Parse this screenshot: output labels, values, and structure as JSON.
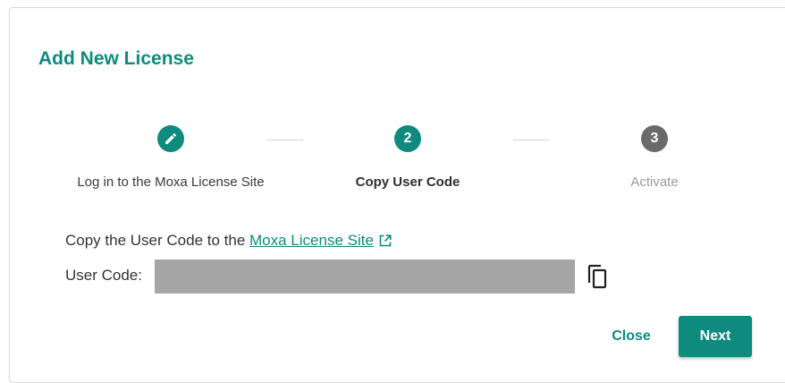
{
  "dialog": {
    "title": "Add New License"
  },
  "stepper": {
    "steps": [
      {
        "label": "Log in to the Moxa License Site",
        "number": "1",
        "state": "completed",
        "icon": "pencil-icon"
      },
      {
        "label": "Copy User Code",
        "number": "2",
        "state": "active"
      },
      {
        "label": "Activate",
        "number": "3",
        "state": "pending"
      }
    ]
  },
  "content": {
    "instruction_prefix": "Copy the User Code to the",
    "link_text": "Moxa License Site",
    "link_icon": "external-link-icon",
    "user_code_label": "User Code:",
    "user_code_value": "",
    "copy_icon": "copy-icon"
  },
  "actions": {
    "close_label": "Close",
    "next_label": "Next"
  },
  "colors": {
    "accent": "#0e8a7e",
    "pending_step": "#6a6a6a",
    "masked_field": "#a6a6a6"
  }
}
